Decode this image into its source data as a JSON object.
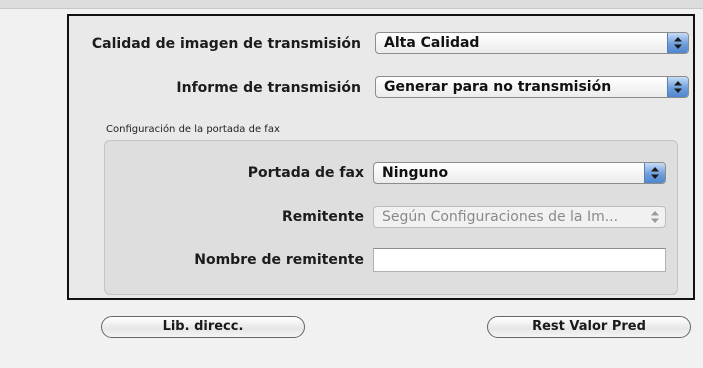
{
  "fields": {
    "image_quality": {
      "label": "Calidad de imagen de transmisión",
      "value": "Alta Calidad"
    },
    "transmission_report": {
      "label": "Informe de transmisión",
      "value": "Generar para no transmisión"
    }
  },
  "cover_sheet": {
    "caption": "Configuración de la portada de fax",
    "cover": {
      "label": "Portada de fax",
      "value": "Ninguno"
    },
    "sender": {
      "label": "Remitente",
      "value": "Según Configuraciones de la Im..."
    },
    "sender_name": {
      "label": "Nombre de remitente",
      "value": ""
    }
  },
  "buttons": {
    "address_book": "Lib. direcc.",
    "restore_defaults": "Rest Valor Pred"
  },
  "icons": {
    "popup_arrows": "up-down-arrows-icon"
  }
}
